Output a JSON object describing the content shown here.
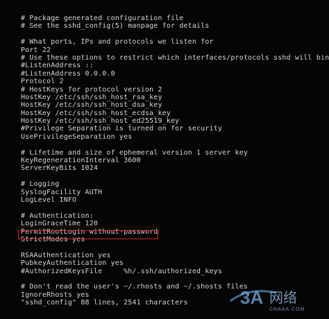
{
  "terminal": {
    "lines": [
      "# Package generated configuration file",
      "# See the sshd_config(5) manpage for details",
      "",
      "# What ports, IPs and protocols we listen for",
      "Port 22",
      "# Use these options to restrict which interfaces/protocols sshd will bind to",
      "#ListenAddress ::",
      "#ListenAddress 0.0.0.0",
      "Protocol 2",
      "# HostKeys for protocol version 2",
      "HostKey /etc/ssh/ssh_host_rsa_key",
      "HostKey /etc/ssh/ssh_host_dsa_key",
      "HostKey /etc/ssh/ssh_host_ecdsa_key",
      "HostKey /etc/ssh/ssh_host_ed25519_key",
      "#Privilege Separation is turned on for security",
      "UsePrivilegeSeparation yes",
      "",
      "# Lifetime and size of ephemeral version 1 server key",
      "KeyRegenerationInterval 3600",
      "ServerKeyBits 1024",
      "",
      "# Logging",
      "SyslogFacility AUTH",
      "LogLevel INFO",
      "",
      "# Authentication:",
      "LoginGraceTime 120",
      "PermitRootLogin without-password",
      "StrictModes yes",
      "",
      "RSAAuthentication yes",
      "PubkeyAuthentication yes",
      "#AuthorizedKeysFile     %h/.ssh/authorized_keys",
      "",
      "# Don't read the user's ~/.rhosts and ~/.shosts files",
      "IgnoreRhosts yes",
      "\"sshd_config\" 88 lines, 2541 characters"
    ],
    "text_color": "#d6d6d6",
    "background": "#050505",
    "highlight_color": "#d9232e"
  },
  "watermark": {
    "logo_text": "3A",
    "cn_text": "网络",
    "sub_text": "CNAAA.COM"
  }
}
